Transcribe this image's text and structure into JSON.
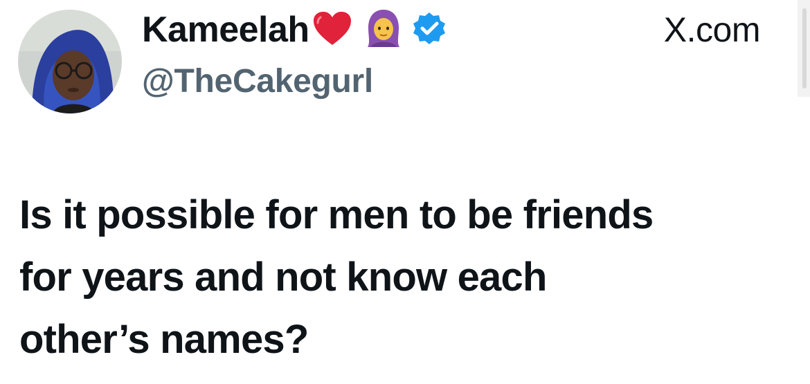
{
  "tweet": {
    "author": {
      "display_name": "Kameelah",
      "handle": "@TheCakegurl",
      "verified": true,
      "name_emojis": [
        "red-heart",
        "woman-with-headscarf"
      ],
      "avatar": "profile-photo"
    },
    "source_label": "X.com",
    "text_lines": [
      "Is it possible for men to be friends",
      "for years and not know each",
      "other’s names?"
    ]
  },
  "colors": {
    "text_primary": "#0f1419",
    "text_secondary": "#536471",
    "verified_badge": "#1d9bf0",
    "heart": "#e0223a",
    "background": "#ffffff"
  }
}
